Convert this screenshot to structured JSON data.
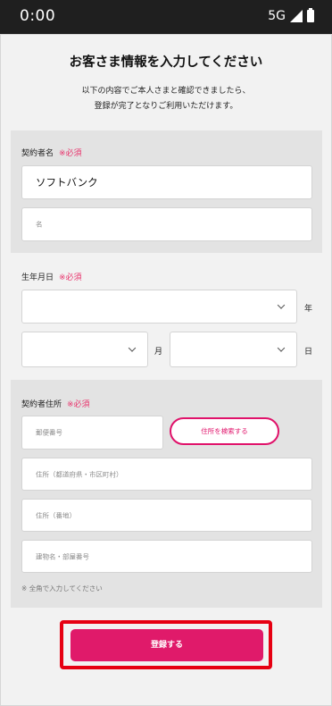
{
  "status_bar": {
    "time": "0:00",
    "network": "5G",
    "signal_icon": "signal-icon",
    "battery_icon": "battery-icon"
  },
  "page": {
    "title": "お客さま情報を入力してください",
    "intro_line1": "以下の内容でご本人さまと確認できましたら、",
    "intro_line2": "登録が完了となりご利用いただけます。"
  },
  "contract_name": {
    "label": "契約者名",
    "required": "※必須",
    "family_name_value": "ソフトバンク",
    "given_name_placeholder": "名"
  },
  "birth_date": {
    "label": "生年月日",
    "required": "※必須",
    "year_unit": "年",
    "month_unit": "月",
    "day_unit": "日",
    "year_value": "",
    "month_value": "",
    "day_value": ""
  },
  "address": {
    "label": "契約者住所",
    "required": "※必須",
    "postal_placeholder": "郵便番号",
    "search_button": "住所を検索する",
    "prefecture_city_placeholder": "住所（都道府県・市区町村）",
    "block_placeholder": "住所（番地）",
    "building_placeholder": "建物名・部屋番号",
    "note": "※ 全角で入力してください"
  },
  "submit_button": "登録する",
  "colors": {
    "accent": "#e01a6a",
    "required": "#e8326b",
    "highlight": "#e60012",
    "panel": "#e3e3e3",
    "background": "#f2f2f2",
    "status_bar": "#1f1f1f"
  }
}
